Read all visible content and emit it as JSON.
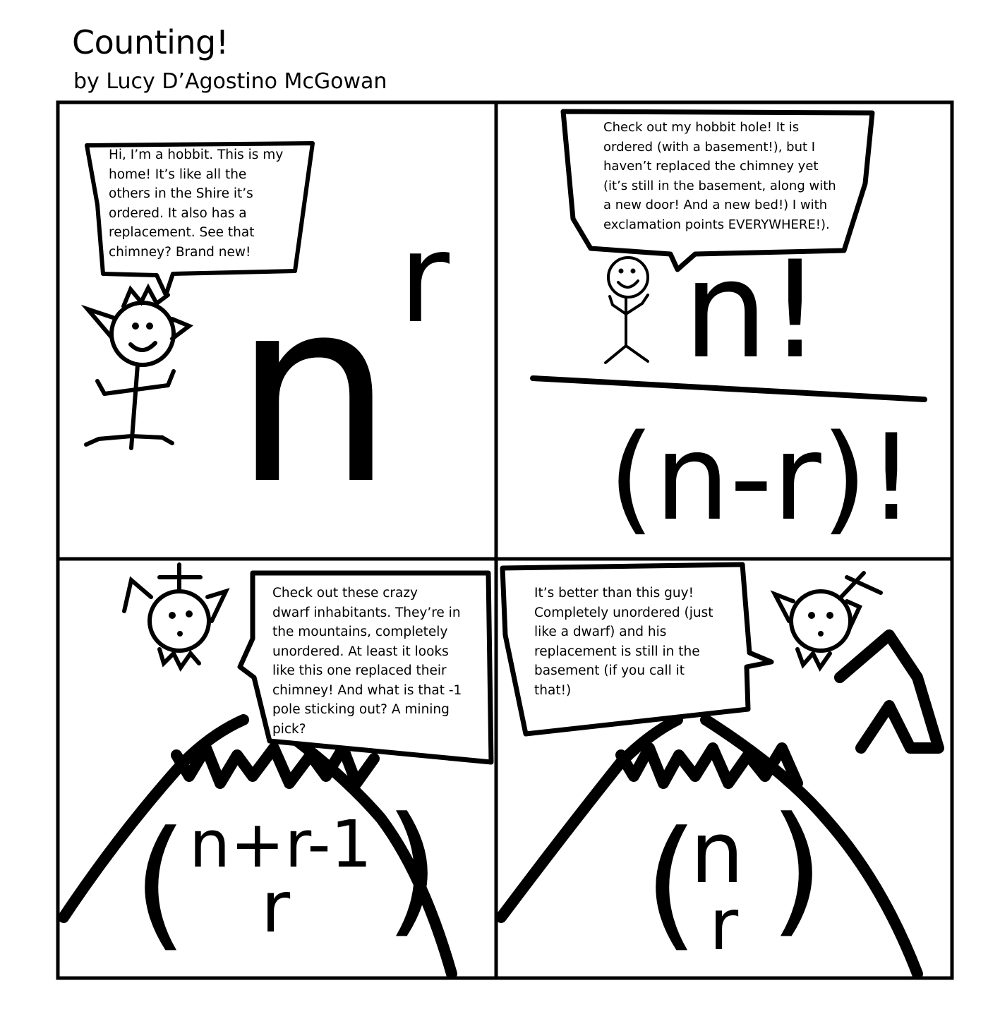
{
  "comic": {
    "title": "Counting!",
    "author_line": "by Lucy D’Agostino McGowan"
  },
  "panels": [
    {
      "id": "panel-1",
      "speech": "Hi, I’m a hobbit. This is my\nhome! It’s like all the\nothers in the Shire it’s\nordered. It also has a\nreplacement. See that\nchimney? Brand new!",
      "formula_base": "n",
      "formula_exponent": "r"
    },
    {
      "id": "panel-2",
      "speech": "Check out my hobbit hole! It is\nordered (with a basement!), but I\nhaven’t replaced the chimney yet\n(it’s still in the basement, along with\na new door! And a new bed!) I with\nexclamation points EVERYWHERE!).",
      "numerator": "n!",
      "denominator": "(n-r)!"
    },
    {
      "id": "panel-3",
      "speech": "Check out these crazy\ndwarf inhabitants. They’re in\nthe mountains, completely\nunordered. At least it looks\nlike this one replaced their\nchimney! And what is that -1\npole sticking out? A mining\npick?",
      "binom_top": "n+r-1",
      "binom_bottom": "r"
    },
    {
      "id": "panel-4",
      "speech": "It’s better than this guy!\nCompletely unordered (just\nlike a dwarf) and his\nreplacement is still in the\nbasement (if you call it\nthat!)",
      "binom_top": "n",
      "binom_bottom": "r"
    }
  ]
}
